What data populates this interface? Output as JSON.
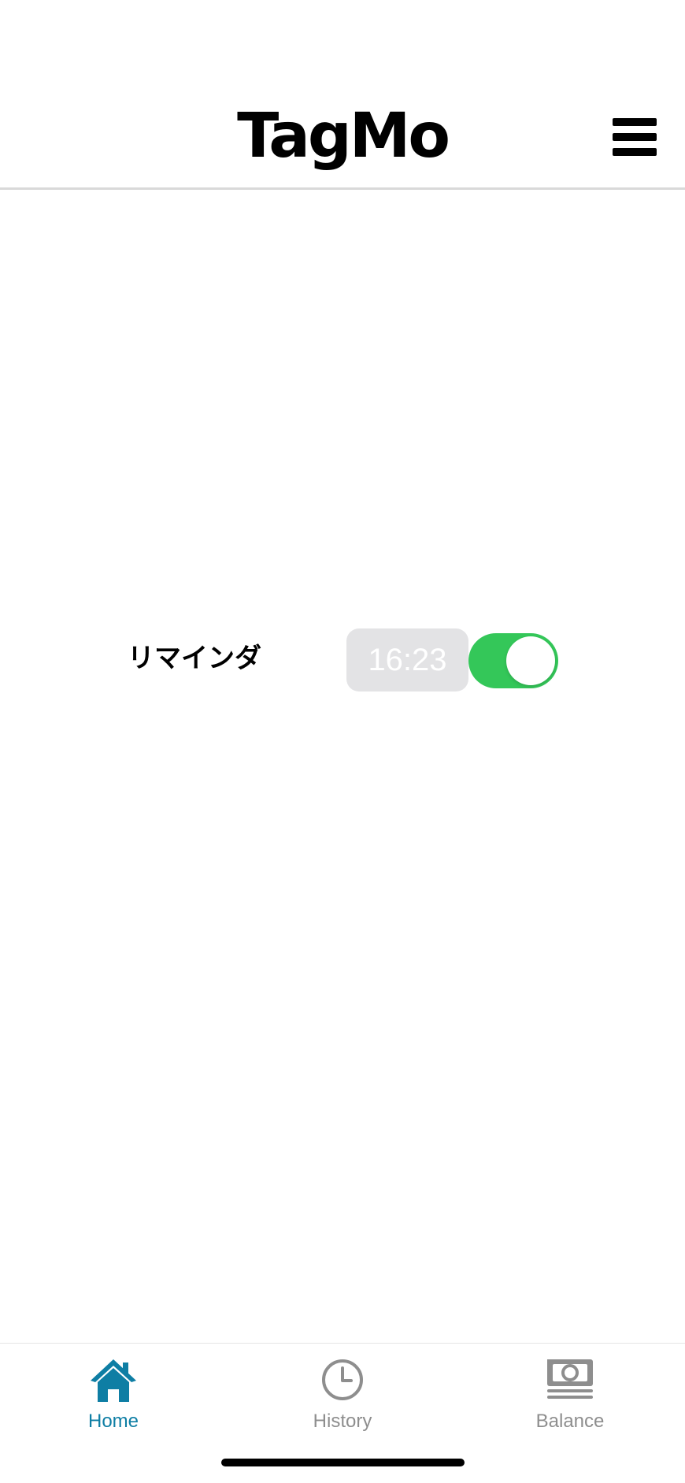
{
  "header": {
    "title": "TagMo",
    "menu_icon": "hamburger-menu-icon"
  },
  "reminder": {
    "label": "リマインダ",
    "time": "16:23",
    "enabled": true
  },
  "tabbar": {
    "active": "home",
    "tabs": [
      {
        "id": "home",
        "label": "Home",
        "icon": "home-icon"
      },
      {
        "id": "history",
        "label": "History",
        "icon": "clock-icon"
      },
      {
        "id": "balance",
        "label": "Balance",
        "icon": "money-icon"
      }
    ]
  },
  "colors": {
    "accent": "#0e7ea4",
    "tab_inactive": "#8e8e8e",
    "toggle_on": "#34c759",
    "time_pill_bg": "#e3e3e5"
  }
}
